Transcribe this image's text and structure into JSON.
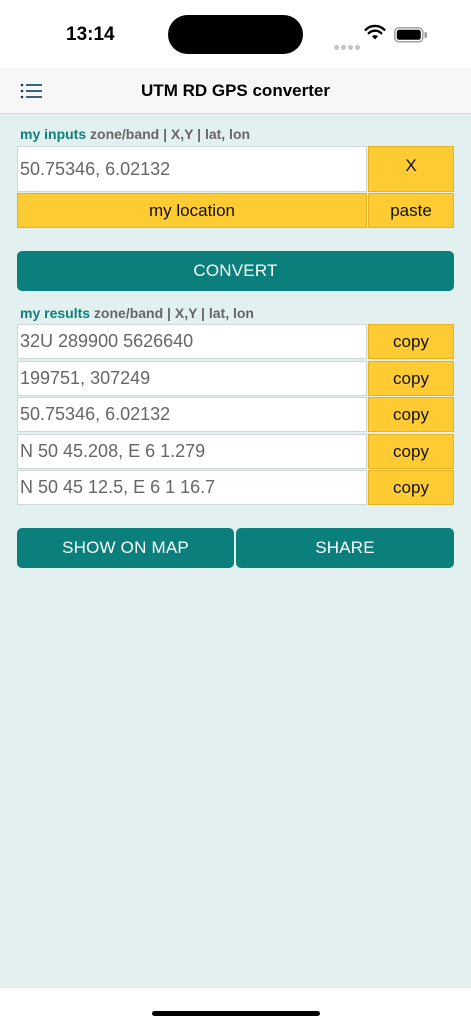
{
  "status": {
    "time": "13:14"
  },
  "nav": {
    "title": "UTM RD GPS converter"
  },
  "inputs": {
    "label_accent": "my inputs",
    "label_rest": " zone/band | X,Y | lat, lon",
    "value": "50.75346, 6.02132",
    "clear_label": "X",
    "location_label": "my location",
    "paste_label": "paste"
  },
  "convert_label": "CONVERT",
  "results": {
    "label_accent": "my results",
    "label_rest": " zone/band | X,Y | lat, lon",
    "rows": [
      {
        "value": "32U 289900 5626640",
        "copy": "copy"
      },
      {
        "value": "199751, 307249",
        "copy": "copy"
      },
      {
        "value": "50.75346, 6.02132",
        "copy": "copy"
      },
      {
        "value": "N 50 45.208, E 6 1.279",
        "copy": "copy"
      },
      {
        "value": "N 50 45 12.5, E 6 1 16.7",
        "copy": "copy"
      }
    ]
  },
  "actions": {
    "map_label": "SHOW ON MAP",
    "share_label": "SHARE"
  },
  "colors": {
    "accent": "#0b7f7b",
    "button_yellow": "#ffcb33",
    "background": "#e2f1ef"
  }
}
